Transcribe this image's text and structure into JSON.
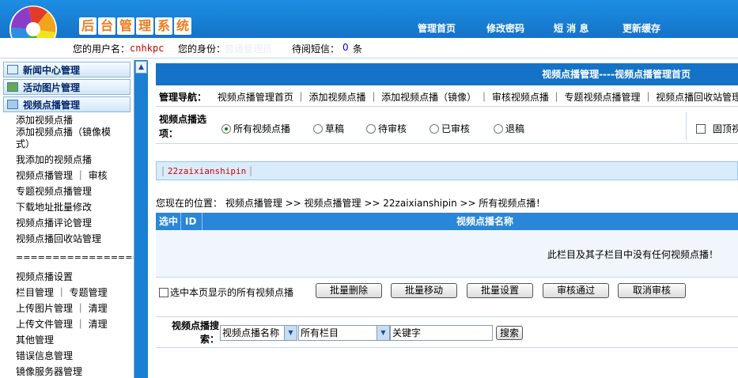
{
  "header": {
    "system_title_chars": [
      "后",
      "台",
      "管",
      "理",
      "系",
      "统"
    ],
    "nav": [
      "管理首页",
      "修改密码",
      "短 消 息",
      "更新缓存"
    ],
    "user_label": "您的用户名：",
    "user_name": "cnhkpc",
    "role_label": "您的身份：",
    "role_value": "普通管理员",
    "msg_label": "待阅短信：",
    "msg_count": "0",
    "msg_unit": "条"
  },
  "sidebar": {
    "groups": [
      "新闻中心管理",
      "活动图片管理",
      "视频点播管理"
    ],
    "items": [
      "添加视频点播",
      "添加视频点播（镜像模式）",
      "我添加的视频点播",
      "视频点播管理 ｜ 审核",
      "专题视频点播管理",
      "下载地址批量修改",
      "视频点播评论管理",
      "视频点播回收站管理",
      "=====================",
      "视频点播设置",
      "栏目管理 ｜ 专题管理",
      "上传图片管理 ｜ 清理",
      "上传文件管理 ｜ 清理",
      "其他管理",
      "错误信息管理",
      "镜像服务器管理"
    ]
  },
  "main": {
    "title": "视频点播管理----视频点播管理首页",
    "nav_label": "管理导航：",
    "nav_links": [
      "视频点播管理首页",
      "添加视频点播",
      "添加视频点播（镜像）",
      "审核视频点播",
      "专题视频点播管理",
      "视频点播回收站管理"
    ],
    "filter_label": "视频点播选项：",
    "filter_options": [
      "所有视频点播",
      "草稿",
      "待审核",
      "已审核",
      "退稿"
    ],
    "top_checkbox_label": "固顶视",
    "channel": "22zaixianshipin",
    "location": "您现在的位置： 视频点播管理 >> 视频点播管理 >> 22zaixianshipin >> 所有视频点播！",
    "table_headers": [
      "选中",
      "ID",
      "视频点播名称"
    ],
    "empty_message": "此栏目及其子栏目中没有任何视频点播！",
    "select_all_label": "选中本页显示的所有视频点播",
    "buttons": [
      "批量删除",
      "批量移动",
      "批量设置",
      "审核通过",
      "取消审核"
    ],
    "search_label": "视频点播搜索：",
    "search_field": "视频点播名称",
    "search_category": "所有栏目",
    "search_keyword": "关键字",
    "search_button": "搜索"
  }
}
